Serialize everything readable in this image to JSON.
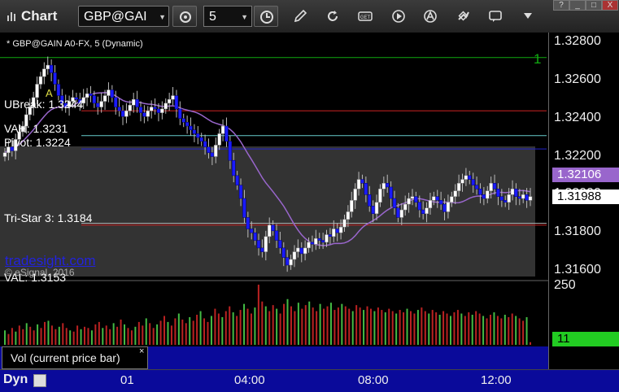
{
  "window": {
    "title": "Chart",
    "symbol": "GBP@GAI",
    "interval": "5",
    "help_button": "?",
    "minimize_button": "_",
    "maximize_button": "□",
    "close_button": "X"
  },
  "chart": {
    "title": "* GBP@GAIN A0-FX, 5 (Dynamic)",
    "watermark": "tradesight.com",
    "copyright": "© eSignal, 2016",
    "marker_a": "A",
    "marker_1": "1"
  },
  "annotations": {
    "ubreak": "UBreak: 1.3244",
    "vah": "VAH: 1.3231",
    "pivot": "Pivot: 1.3224",
    "tristar": "Tri-Star 3: 1.3184",
    "val": "VAL: 1.3153"
  },
  "price_axis": {
    "ticks": [
      "1.32800",
      "1.32600",
      "1.32400",
      "1.32200",
      "1.32000",
      "1.31800",
      "1.31600"
    ],
    "current_price": "1.31988",
    "ma_value": "1.32106"
  },
  "volume_axis": {
    "top_label": "250",
    "current_volume": "11"
  },
  "study": {
    "label": "Vol (current price bar)",
    "close": "×"
  },
  "time_axis": {
    "mode": "Dyn",
    "labels": [
      "01",
      "04:00",
      "08:00",
      "12:00"
    ]
  },
  "colors": {
    "up_candle": "#ffffff",
    "down_candle": "#1a1aff",
    "ma_line": "#9966cc",
    "green_line": "#11aa11",
    "red_line": "#cc2222",
    "cyan_line": "#66cccc",
    "blue_line": "#2222cc",
    "current_price_bg": "#ffffff",
    "ma_value_bg": "#9966cc",
    "volume_label_bg": "#22cc22"
  },
  "chart_data": {
    "type": "candlestick",
    "title": "* GBP@GAIN A0-FX, 5 (Dynamic)",
    "y_axis": {
      "range": [
        1.3157,
        1.3285
      ],
      "ticks": [
        1.328,
        1.326,
        1.324,
        1.322,
        1.32,
        1.318,
        1.316
      ]
    },
    "x_axis": {
      "labels": [
        "01",
        "04:00",
        "08:00",
        "12:00"
      ]
    },
    "levels": [
      {
        "name": "1",
        "value": 1.3272,
        "color": "green"
      },
      {
        "name": "UBreak",
        "value": 1.3244,
        "color": "red"
      },
      {
        "name": "VAH",
        "value": 1.3231,
        "color": "cyan"
      },
      {
        "name": "Pivot",
        "value": 1.3224,
        "color": "blue"
      },
      {
        "name": "Tri-Star 3",
        "value": 1.3184,
        "color": "red"
      },
      {
        "name": "VAL",
        "value": 1.3153,
        "color": "blue"
      }
    ],
    "moving_average_last": 1.32106,
    "last_price": 1.31988,
    "closes": [
      1.3222,
      1.3225,
      1.3223,
      1.3229,
      1.3233,
      1.3236,
      1.3242,
      1.3246,
      1.3251,
      1.3258,
      1.3262,
      1.3266,
      1.3268,
      1.3264,
      1.3258,
      1.3252,
      1.3248,
      1.3246,
      1.3249,
      1.3251,
      1.325,
      1.3248,
      1.3251,
      1.3253,
      1.3252,
      1.3248,
      1.3246,
      1.3249,
      1.3252,
      1.3255,
      1.3251,
      1.3246,
      1.3244,
      1.3241,
      1.3244,
      1.3247,
      1.325,
      1.3246,
      1.3243,
      1.3241,
      1.3244,
      1.3246,
      1.3245,
      1.3243,
      1.3245,
      1.3248,
      1.325,
      1.3252,
      1.3245,
      1.324,
      1.3238,
      1.3236,
      1.3234,
      1.3232,
      1.323,
      1.3228,
      1.3225,
      1.3222,
      1.322,
      1.3226,
      1.3232,
      1.3236,
      1.3228,
      1.3218,
      1.321,
      1.3205,
      1.3198,
      1.3188,
      1.3182,
      1.318,
      1.3176,
      1.3172,
      1.317,
      1.3178,
      1.3184,
      1.3181,
      1.3176,
      1.3172,
      1.3167,
      1.3163,
      1.3166,
      1.317,
      1.3172,
      1.3169,
      1.3172,
      1.3175,
      1.3174,
      1.3177,
      1.3176,
      1.3175,
      1.3179,
      1.3178,
      1.3182,
      1.318,
      1.3183,
      1.3187,
      1.3191,
      1.3197,
      1.3203,
      1.3208,
      1.3206,
      1.32,
      1.3194,
      1.319,
      1.3196,
      1.3203,
      1.3206,
      1.3204,
      1.3198,
      1.3193,
      1.3188,
      1.3192,
      1.3195,
      1.3198,
      1.3199,
      1.3196,
      1.3192,
      1.319,
      1.3193,
      1.3197,
      1.3199,
      1.3197,
      1.3195,
      1.3191,
      1.3196,
      1.3199,
      1.3202,
      1.3206,
      1.3208,
      1.321,
      1.3208,
      1.3205,
      1.3203,
      1.32,
      1.3198,
      1.3202,
      1.3206,
      1.3203,
      1.3199,
      1.3197,
      1.3196,
      1.32,
      1.3203,
      1.3199,
      1.3198,
      1.32,
      1.3197,
      1.3199
    ],
    "volumes": [
      60,
      45,
      70,
      55,
      80,
      65,
      90,
      75,
      60,
      85,
      70,
      95,
      100,
      80,
      65,
      75,
      90,
      70,
      60,
      55,
      80,
      65,
      75,
      70,
      60,
      85,
      95,
      70,
      80,
      65,
      90,
      75,
      105,
      85,
      70,
      60,
      75,
      95,
      80,
      110,
      90,
      70,
      85,
      100,
      120,
      95,
      80,
      110,
      130,
      105,
      90,
      115,
      100,
      125,
      140,
      110,
      95,
      120,
      150,
      130,
      115,
      140,
      160,
      135,
      120,
      145,
      170,
      150,
      130,
      155,
      250,
      180,
      160,
      140,
      165,
      150,
      130,
      170,
      190,
      160,
      140,
      175,
      150,
      165,
      180,
      155,
      140,
      170,
      150,
      160,
      175,
      145,
      155,
      170,
      160,
      150,
      140,
      165,
      155,
      145,
      160,
      150,
      140,
      155,
      145,
      135,
      150,
      140,
      130,
      145,
      135,
      150,
      140,
      130,
      145,
      155,
      140,
      130,
      145,
      135,
      125,
      140,
      130,
      120,
      135,
      145,
      130,
      120,
      135,
      125,
      140,
      130,
      120,
      110,
      125,
      135,
      120,
      110,
      125,
      115,
      130,
      120,
      110,
      100,
      115,
      11
    ]
  }
}
